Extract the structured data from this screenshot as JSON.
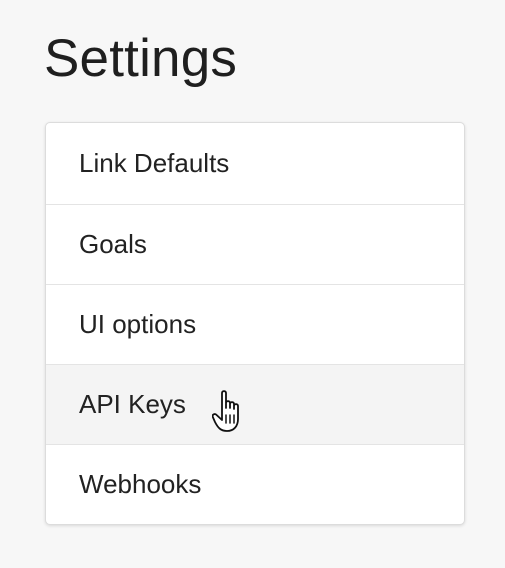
{
  "header": {
    "title": "Settings"
  },
  "settings": {
    "items": [
      {
        "label": "Link Defaults"
      },
      {
        "label": "Goals"
      },
      {
        "label": "UI options"
      },
      {
        "label": "API Keys",
        "hovered": true
      },
      {
        "label": "Webhooks"
      }
    ]
  },
  "cursor": {
    "icon": "hand-pointer-icon"
  }
}
